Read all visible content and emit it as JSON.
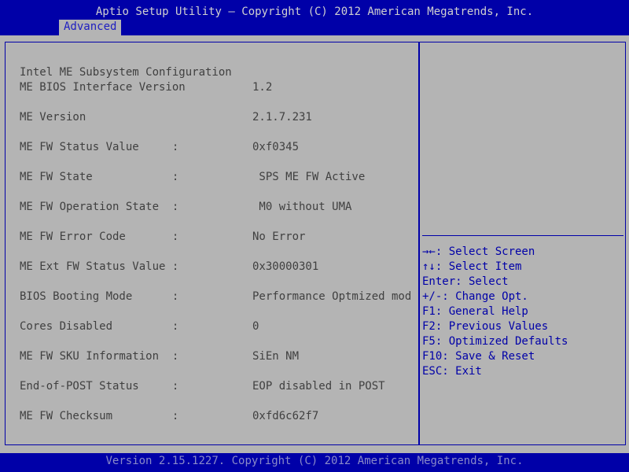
{
  "header": {
    "title": "Aptio Setup Utility – Copyright (C) 2012 American Megatrends, Inc.",
    "tab_advanced": "Advanced"
  },
  "section": {
    "heading": "Intel ME Subsystem Configuration"
  },
  "settings": [
    {
      "label": "ME BIOS Interface Version",
      "value": "1.2"
    },
    {
      "label": "ME Version",
      "value": "2.1.7.231"
    },
    {
      "label": "ME FW Status Value     :",
      "value": "0xf0345"
    },
    {
      "label": "ME FW State            :",
      "value": " SPS ME FW Active"
    },
    {
      "label": "ME FW Operation State  :",
      "value": " M0 without UMA"
    },
    {
      "label": "ME FW Error Code       :",
      "value": "No Error"
    },
    {
      "label": "ME Ext FW Status Value :",
      "value": "0x30000301"
    },
    {
      "label": "BIOS Booting Mode      :",
      "value": "Performance Optmized mod"
    },
    {
      "label": "Cores Disabled         :",
      "value": "0"
    },
    {
      "label": "ME FW SKU Information  :",
      "value": "SiEn NM"
    },
    {
      "label": "End-of-POST Status     :",
      "value": "EOP disabled in POST"
    },
    {
      "label": "ME FW Checksum         :",
      "value": "0xfd6c62f7"
    }
  ],
  "help": [
    "→←: Select Screen",
    "↑↓: Select Item",
    "Enter: Select",
    "+/-: Change Opt.",
    "F1: General Help",
    "F2: Previous Values",
    "F5: Optimized Defaults",
    "F10: Save & Reset",
    "ESC: Exit"
  ],
  "footer": {
    "text": "Version 2.15.1227. Copyright (C) 2012 American Megatrends, Inc."
  },
  "colors": {
    "bar_blue": "#0000a8",
    "panel_gray": "#b4b4b4",
    "text_gray": "#404040",
    "help_blue": "#0000a8"
  }
}
